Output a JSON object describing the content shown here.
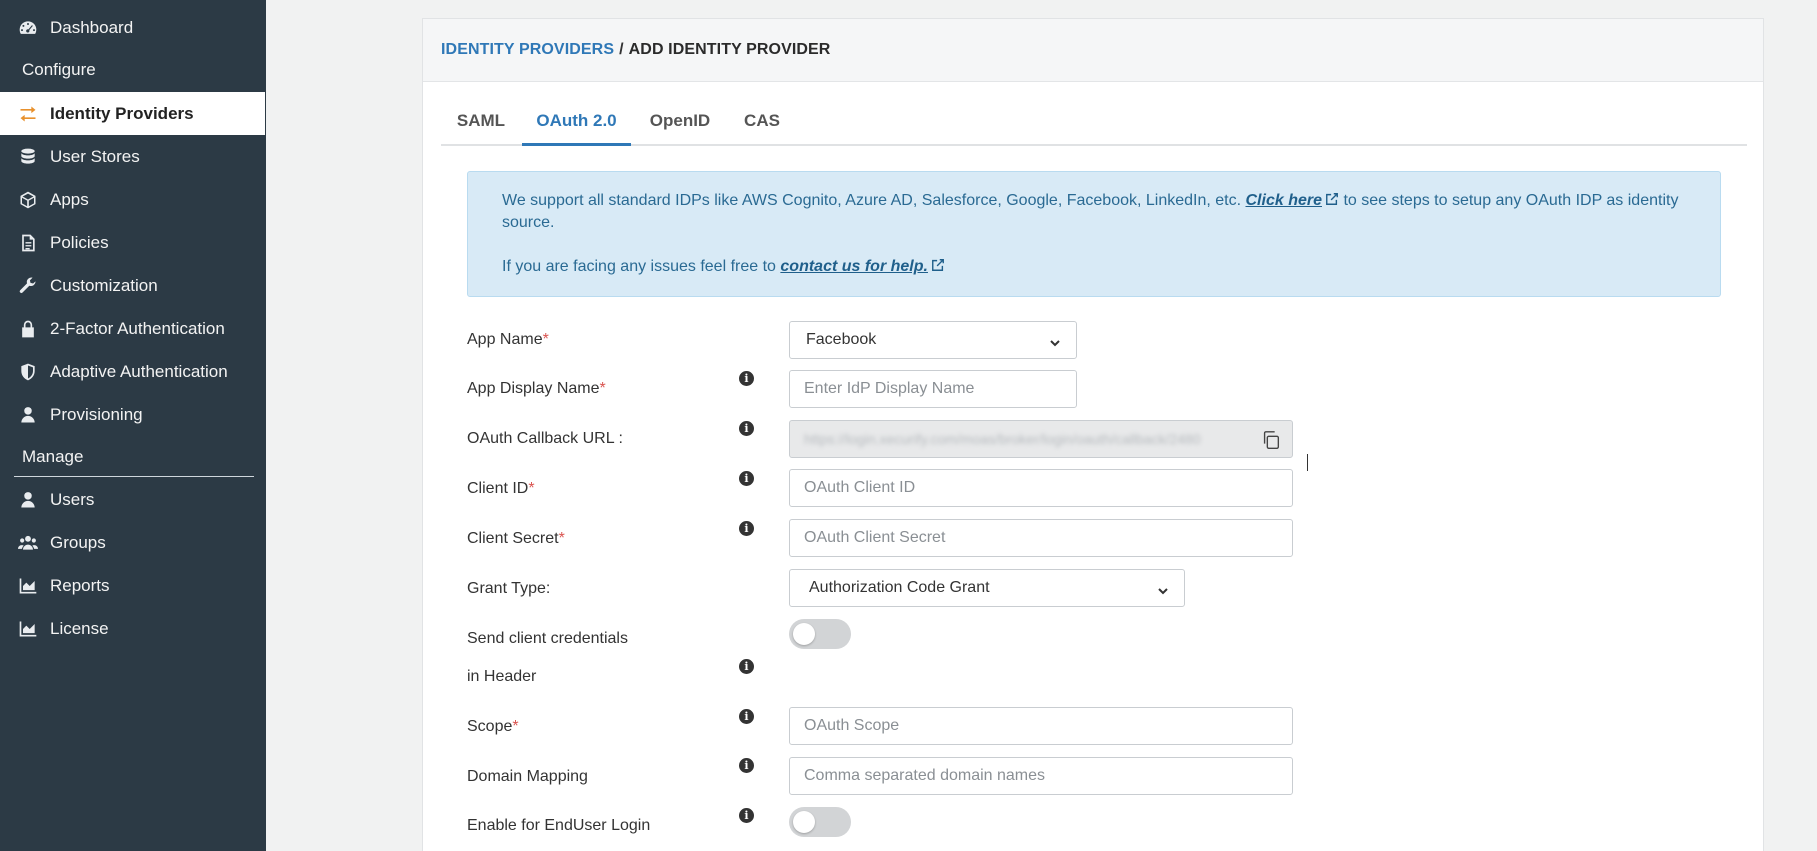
{
  "sidebar": {
    "items_top": [
      {
        "label": "Dashboard",
        "icon": "gauge-icon"
      }
    ],
    "section_configure": "Configure",
    "items_configure": [
      {
        "label": "Identity Providers",
        "icon": "arrows-exchange-icon",
        "active": true
      },
      {
        "label": "User Stores",
        "icon": "database-icon"
      },
      {
        "label": "Apps",
        "icon": "cube-icon"
      },
      {
        "label": "Policies",
        "icon": "document-icon"
      },
      {
        "label": "Customization",
        "icon": "wrench-icon"
      },
      {
        "label": "2-Factor Authentication",
        "icon": "lock-icon"
      },
      {
        "label": "Adaptive Authentication",
        "icon": "shield-icon"
      },
      {
        "label": "Provisioning",
        "icon": "user-icon"
      }
    ],
    "section_manage": "Manage",
    "items_manage": [
      {
        "label": "Users",
        "icon": "user-icon"
      },
      {
        "label": "Groups",
        "icon": "group-icon"
      },
      {
        "label": "Reports",
        "icon": "area-chart-icon"
      },
      {
        "label": "License",
        "icon": "area-chart-icon"
      }
    ],
    "active_color": "#e8912d"
  },
  "breadcrumb": {
    "parent": "IDENTITY PROVIDERS",
    "separator": "/",
    "current": "ADD IDENTITY PROVIDER"
  },
  "tabs": [
    {
      "label": "SAML"
    },
    {
      "label": "OAuth 2.0",
      "active": true
    },
    {
      "label": "OpenID"
    },
    {
      "label": "CAS"
    }
  ],
  "alert": {
    "line1_text": "We support all standard IDPs like AWS Cognito, Azure AD, Salesforce, Google, Facebook, LinkedIn, etc.",
    "line1_link": "Click here",
    "line1_after": "to see steps to setup any OAuth IDP as identity source.",
    "line2_text": "If you are facing any issues feel free to",
    "line2_link": "contact us for help."
  },
  "form": {
    "app_name": {
      "label": "App Name",
      "value": "Facebook"
    },
    "app_display_name": {
      "label": "App Display Name",
      "placeholder": "Enter IdP Display Name"
    },
    "callback_url": {
      "label": "OAuth Callback URL :",
      "value": "https://login.xecurify.com/moas/broker/login/oauth/callback/2480"
    },
    "client_id": {
      "label": "Client ID",
      "placeholder": "OAuth Client ID"
    },
    "client_secret": {
      "label": "Client Secret",
      "placeholder": "OAuth Client Secret"
    },
    "grant_type": {
      "label": "Grant Type:",
      "value": "Authorization Code Grant"
    },
    "send_credentials": {
      "label_line1": "Send client credentials",
      "label_line2": "in Header",
      "enabled": false
    },
    "scope": {
      "label": "Scope",
      "placeholder": "OAuth Scope"
    },
    "domain_mapping": {
      "label": "Domain Mapping",
      "placeholder": "Comma separated domain names"
    },
    "enduser_login": {
      "label": "Enable for EndUser Login",
      "enabled": false
    },
    "required_mark": "*",
    "info_glyph": "i"
  },
  "colors": {
    "sidebar_bg": "#2c3a45",
    "link_blue": "#2f78b7",
    "alert_bg": "#d8eaf6",
    "required_red": "#d9534f"
  }
}
